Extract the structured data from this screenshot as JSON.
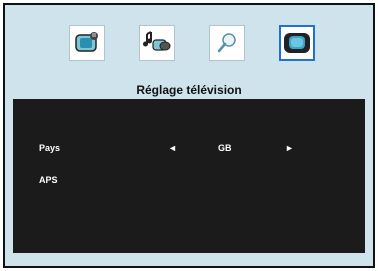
{
  "header": {
    "title": "Réglage télévision"
  },
  "toolbar": {
    "icons": [
      {
        "name": "tv-image-icon"
      },
      {
        "name": "audio-icon"
      },
      {
        "name": "search-icon"
      },
      {
        "name": "tv-settings-icon"
      }
    ]
  },
  "settings": {
    "rows": [
      {
        "label": "Pays",
        "left_arrow": "◄",
        "value": "GB",
        "right_arrow": "►"
      },
      {
        "label": "APS"
      }
    ]
  },
  "colors": {
    "background": "#cfe3ec",
    "panel": "#1c1b1b",
    "selected_border": "#1e73d1"
  }
}
